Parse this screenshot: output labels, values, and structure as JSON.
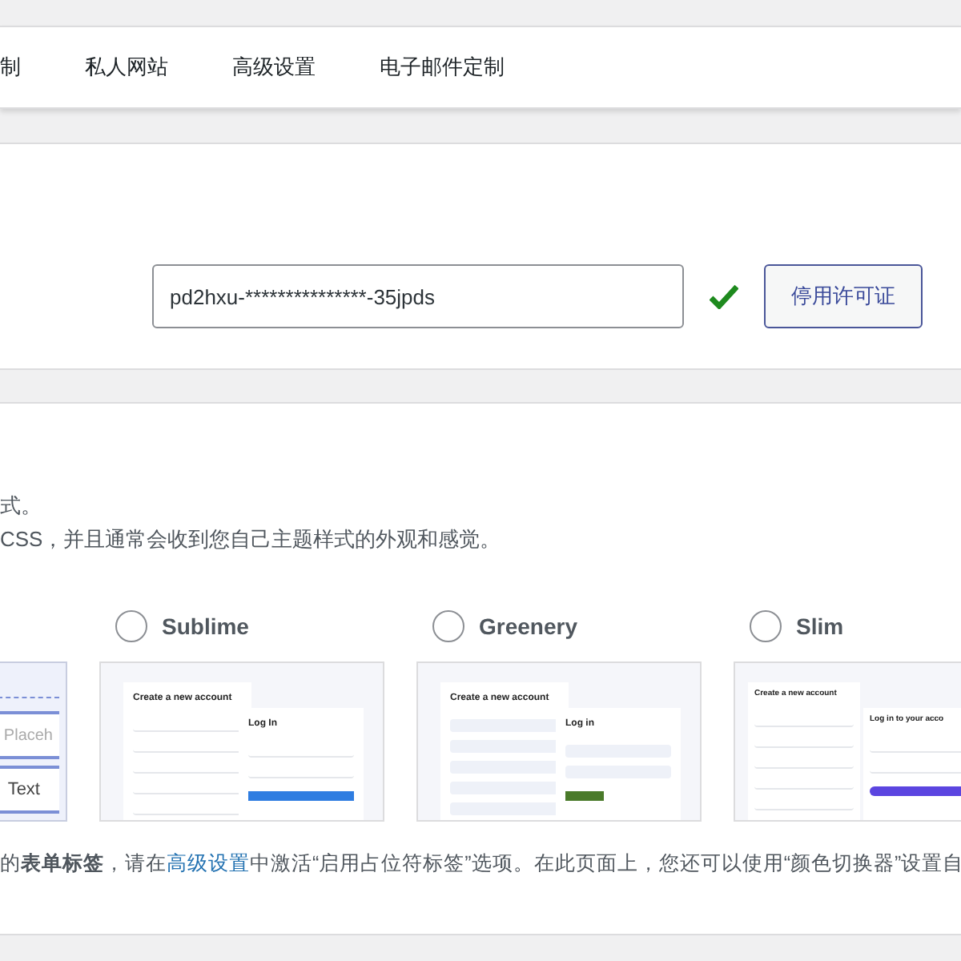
{
  "nav_tabs": [
    {
      "label": "制",
      "selected": false
    },
    {
      "label": "私人网站",
      "selected": false
    },
    {
      "label": "高级设置",
      "selected": false
    },
    {
      "label": "电子邮件定制",
      "selected": false
    }
  ],
  "license": {
    "value": "pd2hxu-***************-35jpds",
    "valid": true,
    "button": "停用许可证"
  },
  "description": [
    "式。",
    "CSS，并且通常会收到您自己主题样式的外观和感觉。"
  ],
  "themes": [
    {
      "kind": "cut",
      "texts": [
        "Placeh",
        "Text"
      ]
    },
    {
      "kind": "sublime",
      "label": "Sublime",
      "selected": false,
      "texts": [
        "Create a new account",
        "Log In"
      ]
    },
    {
      "kind": "greenery",
      "label": "Greenery",
      "selected": false,
      "texts": [
        "Create a new account",
        "Log in"
      ]
    },
    {
      "kind": "slim",
      "label": "Slim",
      "selected": false,
      "texts": [
        "Create a new account",
        "Log in to your acco"
      ]
    }
  ],
  "note": {
    "before": "的**表单标签**，请在",
    "link": "高级设置",
    "after": "中激活“启用占位符标签”选项。在此页面上，您还可以使用“颜色切换器”设置自"
  }
}
